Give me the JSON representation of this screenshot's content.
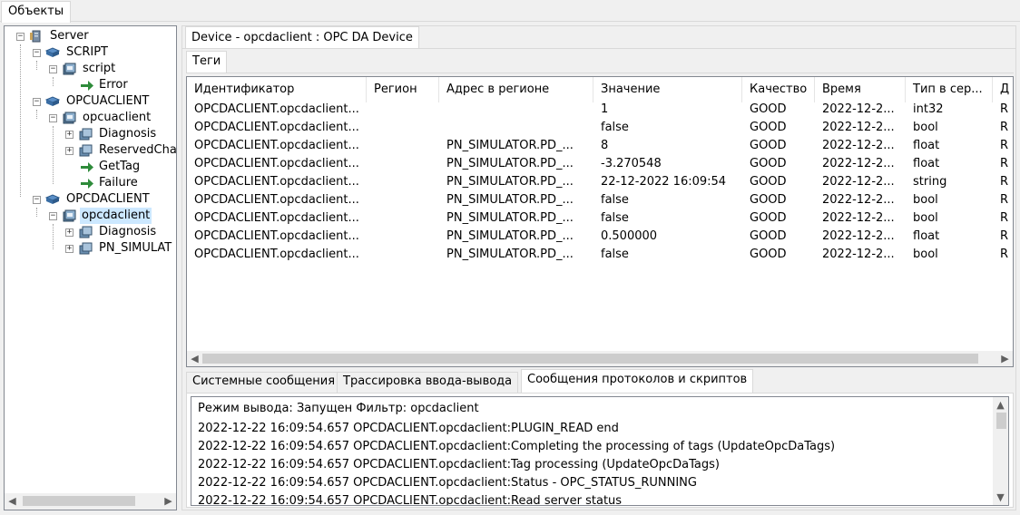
{
  "top_tab": "Объекты",
  "tree": {
    "server": "Server",
    "script_group": "SCRIPT",
    "script": "script",
    "error": "Error",
    "opcua_group": "OPCUACLIENT",
    "opcua_client": "opcuaclient",
    "opcua_diagnosis": "Diagnosis",
    "opcua_reserved": "ReservedCha",
    "opcua_gettag": "GetTag",
    "opcua_failure": "Failure",
    "opcda_group": "OPCDACLIENT",
    "opcda_client": "opcdaclient",
    "opcda_diagnosis": "Diagnosis",
    "opcda_pn": "PN_SIMULAT"
  },
  "device_tab": "Device - opcdaclient : OPC DA Device",
  "tags_tab": "Теги",
  "table": {
    "columns": [
      "Идентификатор",
      "Регион",
      "Адрес в регионе",
      "Значение",
      "Качество",
      "Время",
      "Тип в сер...",
      "Д"
    ],
    "rows": [
      [
        "OPCDACLIENT.opcdaclient...",
        "",
        "",
        "1",
        "GOOD",
        "2022-12-2...",
        "int32",
        "R"
      ],
      [
        "OPCDACLIENT.opcdaclient...",
        "",
        "",
        "false",
        "GOOD",
        "2022-12-2...",
        "bool",
        "R"
      ],
      [
        "OPCDACLIENT.opcdaclient...",
        "",
        "PN_SIMULATOR.PD_...",
        "8",
        "GOOD",
        "2022-12-2...",
        "float",
        "R"
      ],
      [
        "OPCDACLIENT.opcdaclient...",
        "",
        "PN_SIMULATOR.PD_...",
        "-3.270548",
        "GOOD",
        "2022-12-2...",
        "float",
        "R"
      ],
      [
        "OPCDACLIENT.opcdaclient...",
        "",
        "PN_SIMULATOR.PD_...",
        "22-12-2022 16:09:54",
        "GOOD",
        "2022-12-2...",
        "string",
        "R"
      ],
      [
        "OPCDACLIENT.opcdaclient...",
        "",
        "PN_SIMULATOR.PD_...",
        "false",
        "GOOD",
        "2022-12-2...",
        "bool",
        "R"
      ],
      [
        "OPCDACLIENT.opcdaclient...",
        "",
        "PN_SIMULATOR.PD_...",
        "false",
        "GOOD",
        "2022-12-2...",
        "bool",
        "R"
      ],
      [
        "OPCDACLIENT.opcdaclient...",
        "",
        "PN_SIMULATOR.PD_...",
        "0.500000",
        "GOOD",
        "2022-12-2...",
        "float",
        "R"
      ],
      [
        "OPCDACLIENT.opcdaclient...",
        "",
        "PN_SIMULATOR.PD_...",
        "false",
        "GOOD",
        "2022-12-2...",
        "bool",
        "R"
      ]
    ]
  },
  "bottom_tabs": [
    "Системные сообщения",
    "Трассировка ввода-вывода",
    "Сообщения протоколов и скриптов"
  ],
  "log": {
    "header": "Режим вывода: Запущен Фильтр: opcdaclient",
    "lines": [
      "2022-12-22 16:09:54.657 OPCDACLIENT.opcdaclient:PLUGIN_READ end",
      "2022-12-22 16:09:54.657 OPCDACLIENT.opcdaclient:Completing the processing of tags (UpdateOpcDaTags)",
      "2022-12-22 16:09:54.657 OPCDACLIENT.opcdaclient:Tag processing (UpdateOpcDaTags)",
      "2022-12-22 16:09:54.657 OPCDACLIENT.opcdaclient:Status - OPC_STATUS_RUNNING",
      "2022-12-22 16:09:54.657 OPCDACLIENT.opcdaclient:Read server status"
    ]
  },
  "icons": {
    "server": "server-icon",
    "group": "folder-icon",
    "device": "device-icon",
    "event": "green-arrow-icon",
    "collapse": "minus",
    "expand": "plus",
    "scroll_left": "◀",
    "scroll_right": "▶",
    "scroll_up": "▲",
    "scroll_down": "▼"
  },
  "colors": {
    "selection": "#cce8ff",
    "border": "#828790",
    "arrow_green": "#2e8b3a"
  }
}
